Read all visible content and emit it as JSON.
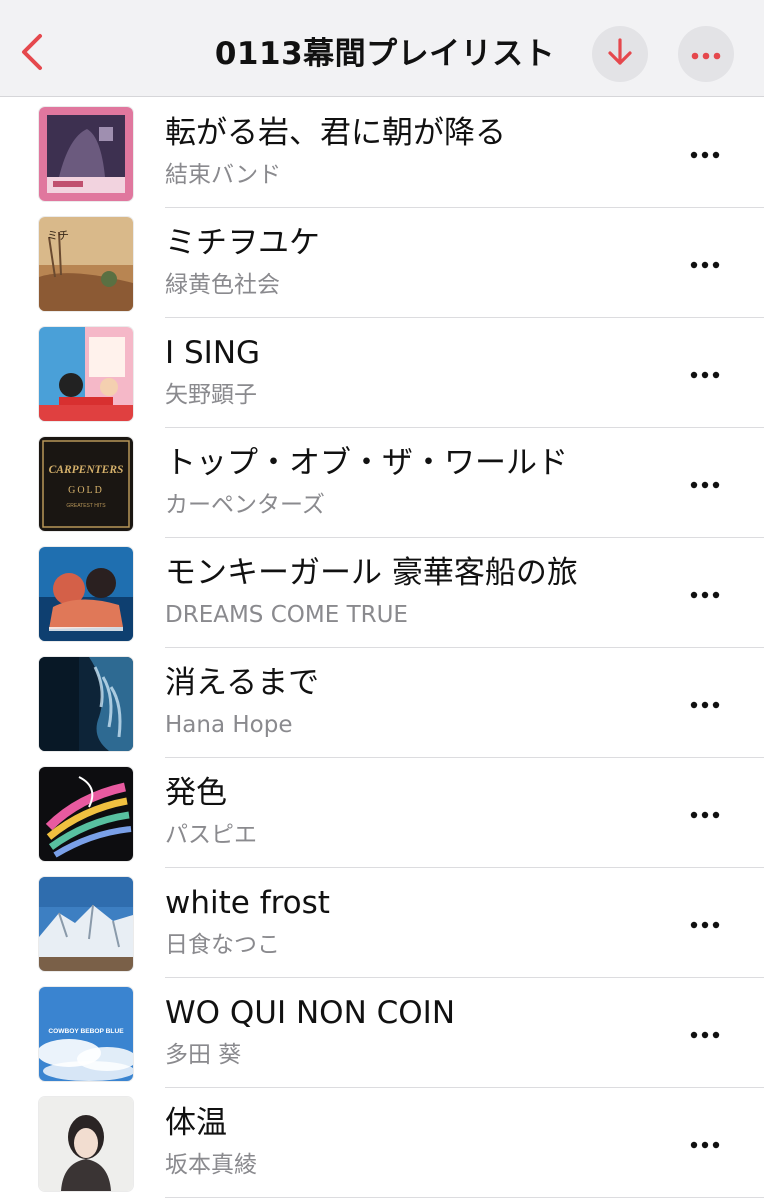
{
  "navbar": {
    "title": "0113幕間プレイリスト",
    "back_icon": "chevron-left-icon",
    "download_icon": "arrow-down-icon",
    "more_icon": "ellipsis-icon",
    "accent_color": "#e5484d"
  },
  "tracks": [
    {
      "title": "転がる岩、君に朝が降る",
      "artist": "結束バンド",
      "artwork": "pink"
    },
    {
      "title": "ミチヲユケ",
      "artist": "緑黄色社会",
      "artwork": "desert"
    },
    {
      "title": "I SING",
      "artist": "矢野顕子",
      "artwork": "cafe"
    },
    {
      "title": "トップ・オブ・ザ・ワールド",
      "artist": "カーペンターズ",
      "artwork": "carpenters",
      "artwork_text": [
        "CARPENTERS",
        "GOLD",
        "GREATEST HITS"
      ]
    },
    {
      "title": "モンキーガール 豪華客船の旅",
      "artist": "DREAMS COME TRUE",
      "artwork": "dreams"
    },
    {
      "title": "消えるまで",
      "artist": "Hana Hope",
      "artwork": "water"
    },
    {
      "title": "発色",
      "artist": "パスピエ",
      "artwork": "rainbow"
    },
    {
      "title": "white frost",
      "artist": "日食なつこ",
      "artwork": "mountain"
    },
    {
      "title": "WO QUI NON COIN",
      "artist": "多田 葵",
      "artwork": "sky",
      "artwork_text": [
        "COWBOY BEBOP BLUE"
      ]
    },
    {
      "title": "体温",
      "artist": "坂本真綾",
      "artwork": "portrait"
    }
  ]
}
